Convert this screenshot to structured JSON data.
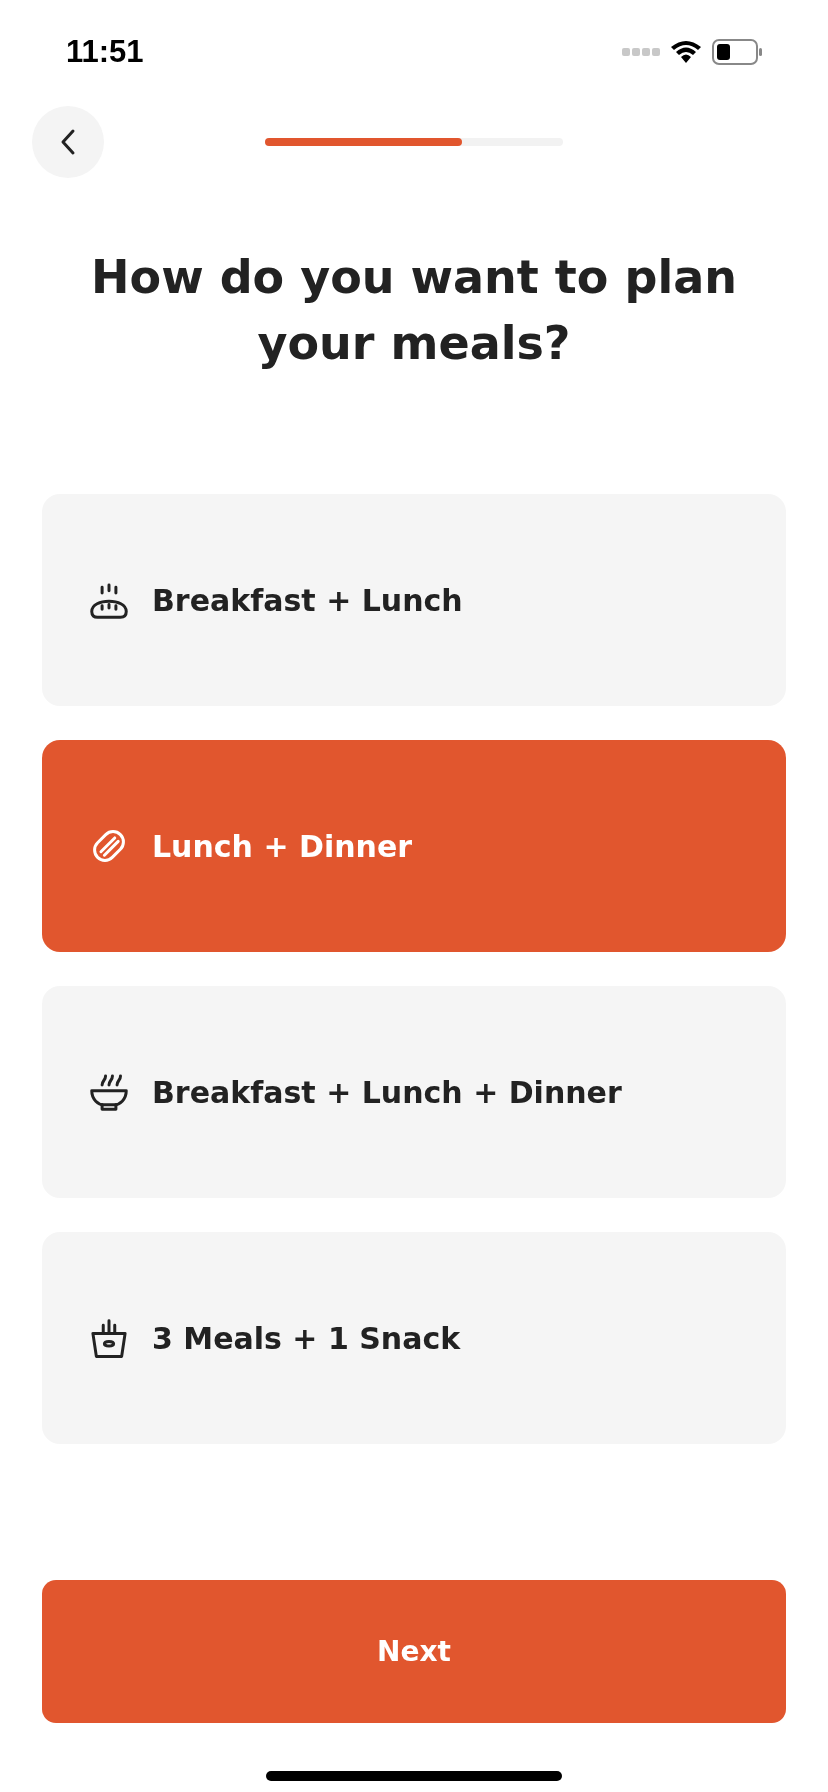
{
  "status_bar": {
    "time": "11:51"
  },
  "progress": {
    "level": 0.66
  },
  "title": "How do you want to plan your meals?",
  "options": [
    {
      "label": "Breakfast + Lunch",
      "kind": "bread",
      "selected": false
    },
    {
      "label": "Lunch + Dinner",
      "kind": "hotdog",
      "selected": true
    },
    {
      "label": "Breakfast + Lunch + Dinner",
      "kind": "bowl",
      "selected": false
    },
    {
      "label": "3 Meals + 1 Snack",
      "kind": "fries",
      "selected": false
    }
  ],
  "next_button": {
    "label": "Next"
  }
}
